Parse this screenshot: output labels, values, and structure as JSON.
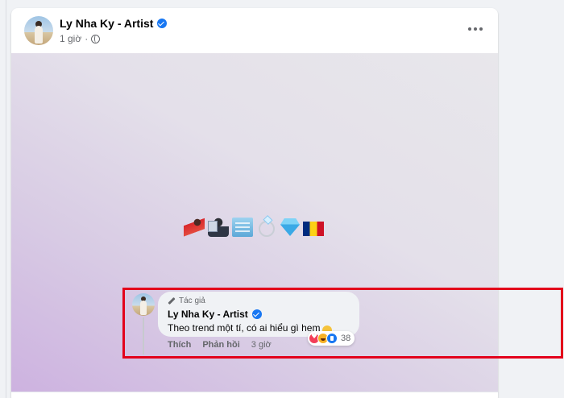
{
  "post": {
    "author": "Ly Nha Ky - Artist",
    "time": "1 giờ",
    "separator": "·",
    "visibility_icon": "globe-icon",
    "more_icon": "more-options-icon"
  },
  "image": {
    "emojis": [
      "woman-dancing-red-dress-emoji",
      "teacher-emoji",
      "office-building-emoji",
      "ring-emoji",
      "gem-stone-emoji",
      "romania-flag-emoji"
    ]
  },
  "comment": {
    "badge": "Tác giả",
    "author": "Ly Nha Ky - Artist",
    "text": "Theo trend một tí, có ai hiểu gì hem",
    "actions": {
      "like": "Thích",
      "reply": "Phản hồi",
      "time": "3 giờ"
    },
    "reactions": {
      "types": [
        "love",
        "haha",
        "like"
      ],
      "count": "38"
    }
  },
  "colors": {
    "accent": "#1877f2",
    "highlight": "#e3001b",
    "background": "#f0f2f5"
  }
}
